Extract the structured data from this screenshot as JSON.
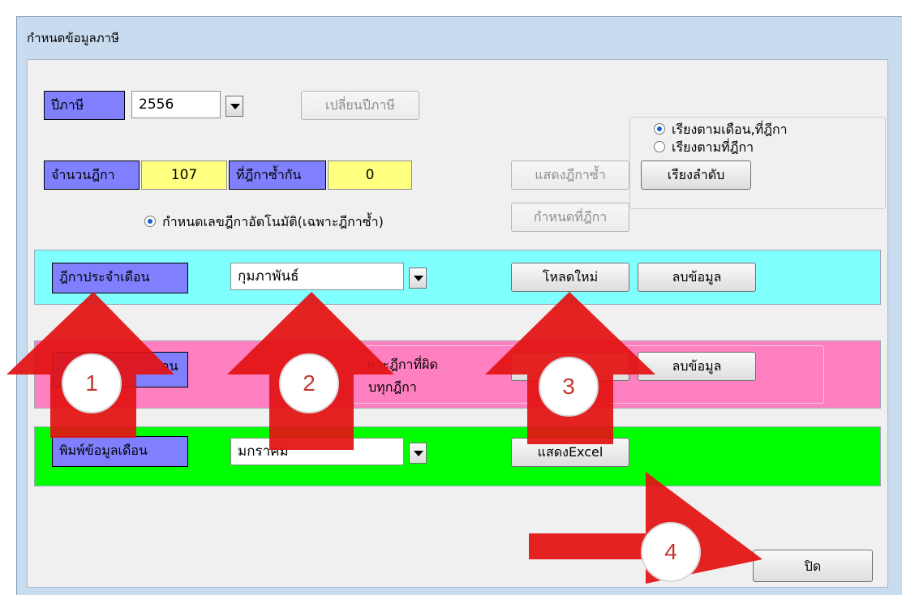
{
  "window": {
    "title": "กำหนดข้อมูลภาษี"
  },
  "tax_year": {
    "label": "ปีภาษี",
    "value": "2556",
    "change_button": "เปลี่ยนปีภาษี"
  },
  "sort": {
    "options": [
      "เรียงตามเดือน,ที่ฎีกา",
      "เรียงตามที่ฎีกา"
    ],
    "selected": 0,
    "button": "เรียงลำดับ"
  },
  "count": {
    "label": "จำนวนฎีกา",
    "value": "107",
    "dup_label": "ที่ฎีกาซ้ำกัน",
    "dup_value": "0",
    "show_dup_button": "แสดงฎีกาซ้ำ"
  },
  "auto_number": {
    "label": "กำหนดเลขฎีกาอัตโนมัติ(เฉพาะฎีกาซ้ำ)",
    "button": "กำหนดที่ฎีกา"
  },
  "monthly": {
    "label": "ฎีกาประจำเดือน",
    "month": "กุมภาพันธ์",
    "reload_button": "โหลดใหม่",
    "delete_button": "ลบข้อมูล"
  },
  "row2": {
    "label_visible": "อน",
    "text_line1": "พาะฎีกาที่ผิด",
    "text_line2": "บทุกฎีกา",
    "delete_button": "ลบข้อมูล"
  },
  "print": {
    "label": "พิมพ์ข้อมูลเดือน",
    "month": "มกราคม",
    "excel_button": "แสดงExcel"
  },
  "close_button": "ปิด",
  "callouts": [
    "1",
    "2",
    "3",
    "4"
  ],
  "colors": {
    "label_bg": "#8080ff",
    "cyan_band": "#80ffff",
    "pink_band": "#ff80c0",
    "green_band": "#00ff00",
    "arrow": "#e31212"
  }
}
